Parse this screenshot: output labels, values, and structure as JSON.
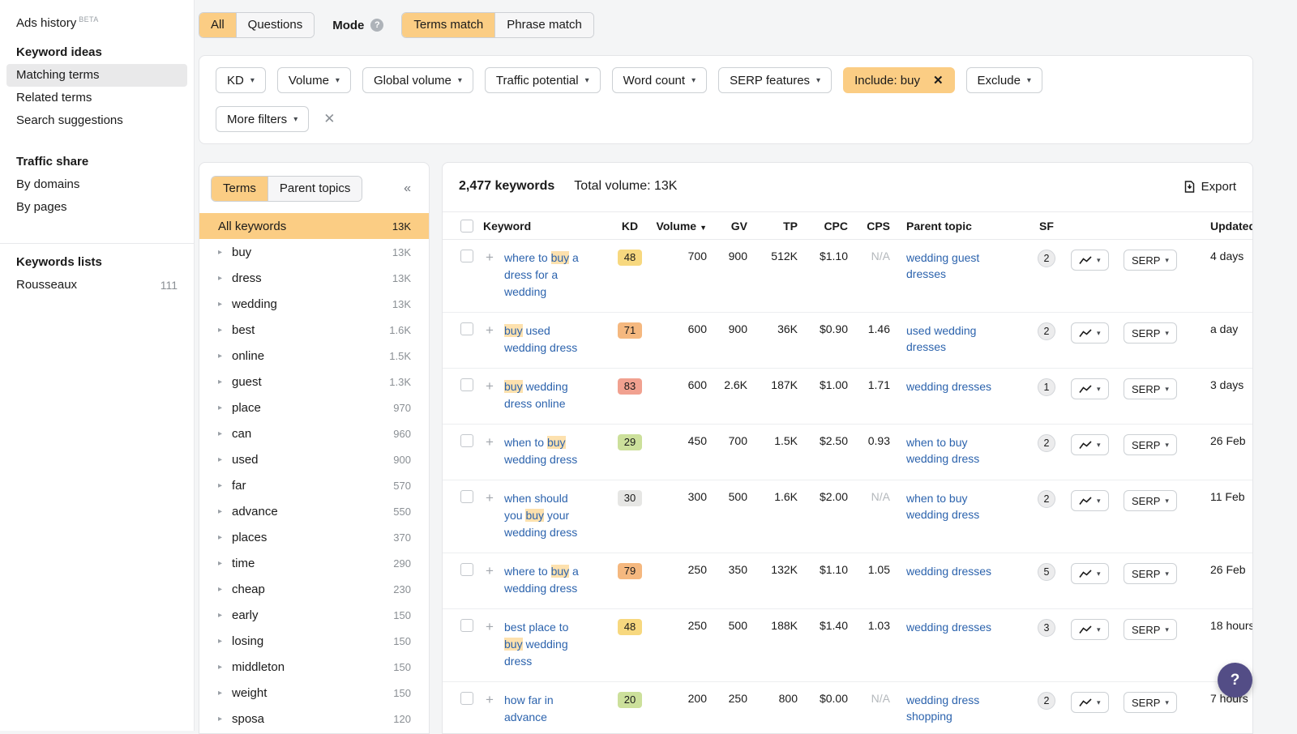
{
  "colors": {
    "accent": "#fbcd84",
    "keyword_highlight": "#fde1ae",
    "link": "#2c63ad",
    "sidebar_selected": "#e9e9ea",
    "help_fab": "#534d86",
    "kd_yellow": "#f7d87f",
    "kd_orange": "#f5b87f",
    "kd_red": "#f1a190",
    "kd_green": "#cce09b",
    "kd_gray": "#e6e6e4"
  },
  "icons": {
    "caret_down": "▾",
    "sort_desc": "▼",
    "chevron_right": "▸",
    "collapse": "«",
    "close": "✕",
    "plus": "+",
    "help": "?"
  },
  "sidebar": {
    "ads_history": {
      "label": "Ads history",
      "badge": "BETA"
    },
    "keyword_ideas": {
      "heading": "Keyword ideas",
      "items": [
        "Matching terms",
        "Related terms",
        "Search suggestions"
      ]
    },
    "traffic_share": {
      "heading": "Traffic share",
      "items": [
        "By domains",
        "By pages"
      ]
    },
    "keywords_lists": {
      "heading": "Keywords lists",
      "items": [
        {
          "label": "Rousseaux",
          "count": "111"
        }
      ]
    }
  },
  "topbar": {
    "scope_tabs": [
      "All",
      "Questions"
    ],
    "mode_label": "Mode",
    "match_tabs": [
      "Terms match",
      "Phrase match"
    ]
  },
  "filters": {
    "dropdowns": [
      "KD",
      "Volume",
      "Global volume",
      "Traffic potential",
      "Word count",
      "SERP features"
    ],
    "include_chip": "Include: buy",
    "exclude": "Exclude",
    "more_filters": "More filters"
  },
  "terms_panel": {
    "tabs": [
      "Terms",
      "Parent topics"
    ],
    "items": [
      {
        "label": "All keywords",
        "count": "13K",
        "selected": true
      },
      {
        "label": "buy",
        "count": "13K"
      },
      {
        "label": "dress",
        "count": "13K"
      },
      {
        "label": "wedding",
        "count": "13K"
      },
      {
        "label": "best",
        "count": "1.6K"
      },
      {
        "label": "online",
        "count": "1.5K"
      },
      {
        "label": "guest",
        "count": "1.3K"
      },
      {
        "label": "place",
        "count": "970"
      },
      {
        "label": "can",
        "count": "960"
      },
      {
        "label": "used",
        "count": "900"
      },
      {
        "label": "far",
        "count": "570"
      },
      {
        "label": "advance",
        "count": "550"
      },
      {
        "label": "places",
        "count": "370"
      },
      {
        "label": "time",
        "count": "290"
      },
      {
        "label": "cheap",
        "count": "230"
      },
      {
        "label": "early",
        "count": "150"
      },
      {
        "label": "losing",
        "count": "150"
      },
      {
        "label": "middleton",
        "count": "150"
      },
      {
        "label": "weight",
        "count": "150"
      },
      {
        "label": "sposa",
        "count": "120"
      }
    ]
  },
  "table": {
    "count_label": "2,477 keywords",
    "total_volume_label": "Total volume: 13K",
    "export_label": "Export",
    "serp_label": "SERP",
    "headers": {
      "keyword": "Keyword",
      "kd": "KD",
      "volume": "Volume",
      "gv": "GV",
      "tp": "TP",
      "cpc": "CPC",
      "cps": "CPS",
      "parent": "Parent topic",
      "sf": "SF",
      "updated": "Updated"
    },
    "rows": [
      {
        "keyword": [
          {
            "t": "where to "
          },
          {
            "t": "buy",
            "h": true
          },
          {
            "t": " a dress for a wedding"
          }
        ],
        "kd": "48",
        "kd_color": "kd_yellow",
        "volume": "700",
        "gv": "900",
        "tp": "512K",
        "cpc": "$1.10",
        "cps": "N/A",
        "parent": "wedding guest dresses",
        "sf": "2",
        "updated": "4 days"
      },
      {
        "keyword": [
          {
            "t": "buy",
            "h": true
          },
          {
            "t": " used wedding dress"
          }
        ],
        "kd": "71",
        "kd_color": "kd_orange",
        "volume": "600",
        "gv": "900",
        "tp": "36K",
        "cpc": "$0.90",
        "cps": "1.46",
        "parent": "used wedding dresses",
        "sf": "2",
        "updated": "a day"
      },
      {
        "keyword": [
          {
            "t": "buy",
            "h": true
          },
          {
            "t": " wedding dress online"
          }
        ],
        "kd": "83",
        "kd_color": "kd_red",
        "volume": "600",
        "gv": "2.6K",
        "tp": "187K",
        "cpc": "$1.00",
        "cps": "1.71",
        "parent": "wedding dresses",
        "sf": "1",
        "updated": "3 days"
      },
      {
        "keyword": [
          {
            "t": "when to "
          },
          {
            "t": "buy",
            "h": true
          },
          {
            "t": " wedding dress"
          }
        ],
        "kd": "29",
        "kd_color": "kd_green",
        "volume": "450",
        "gv": "700",
        "tp": "1.5K",
        "cpc": "$2.50",
        "cps": "0.93",
        "parent": "when to buy wedding dress",
        "sf": "2",
        "updated": "26 Feb"
      },
      {
        "keyword": [
          {
            "t": "when should you "
          },
          {
            "t": "buy",
            "h": true
          },
          {
            "t": " your wedding dress"
          }
        ],
        "kd": "30",
        "kd_color": "kd_gray",
        "volume": "300",
        "gv": "500",
        "tp": "1.6K",
        "cpc": "$2.00",
        "cps": "N/A",
        "parent": "when to buy wedding dress",
        "sf": "2",
        "updated": "11 Feb"
      },
      {
        "keyword": [
          {
            "t": "where to "
          },
          {
            "t": "buy",
            "h": true
          },
          {
            "t": " a wedding dress"
          }
        ],
        "kd": "79",
        "kd_color": "kd_orange",
        "volume": "250",
        "gv": "350",
        "tp": "132K",
        "cpc": "$1.10",
        "cps": "1.05",
        "parent": "wedding dresses",
        "sf": "5",
        "updated": "26 Feb"
      },
      {
        "keyword": [
          {
            "t": "best place to "
          },
          {
            "t": "buy",
            "h": true
          },
          {
            "t": " wedding dress"
          }
        ],
        "kd": "48",
        "kd_color": "kd_yellow",
        "volume": "250",
        "gv": "500",
        "tp": "188K",
        "cpc": "$1.40",
        "cps": "1.03",
        "parent": "wedding dresses",
        "sf": "3",
        "updated": "18 hours"
      },
      {
        "keyword": [
          {
            "t": "how far in advance"
          }
        ],
        "kd": "20",
        "kd_color": "kd_green",
        "volume": "200",
        "gv": "250",
        "tp": "800",
        "cpc": "$0.00",
        "cps": "N/A",
        "parent": "wedding dress shopping",
        "sf": "2",
        "updated": "7 hours"
      }
    ]
  },
  "help": {
    "label": "?"
  }
}
